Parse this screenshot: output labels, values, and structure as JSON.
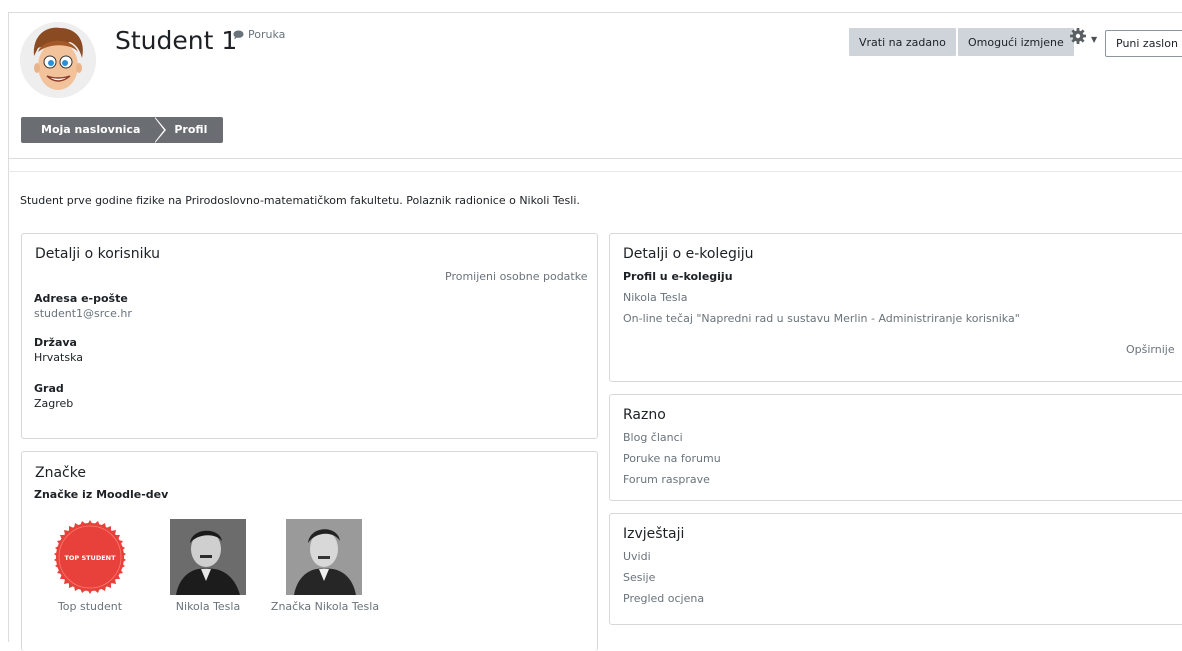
{
  "header": {
    "user_name": "Student 1",
    "message_label": "Poruka",
    "reset_label": "Vrati na zadano",
    "edit_label": "Omogući izmjene",
    "fullscreen_label": "Puni zaslon"
  },
  "breadcrumb": {
    "items": [
      {
        "label": "Moja naslovnica"
      },
      {
        "label": "Profil"
      }
    ]
  },
  "description": "Student prve godine fizike na Prirodoslovno-matematičkom fakultetu. Polaznik radionice o Nikoli Tesli.",
  "user_details": {
    "title": "Detalji o korisniku",
    "edit_link": "Promijeni osobne podatke",
    "fields": [
      {
        "label": "Adresa e-pošte",
        "value": "student1@srce.hr"
      },
      {
        "label": "Država",
        "value": "Hrvatska"
      },
      {
        "label": "Grad",
        "value": "Zagreb"
      }
    ]
  },
  "badges": {
    "title": "Značke",
    "subtitle": "Značke iz Moodle-dev",
    "items": [
      {
        "name": "Top student",
        "seal_text": "TOP STUDENT"
      },
      {
        "name": "Nikola Tesla"
      },
      {
        "name": "Značka Nikola Tesla"
      }
    ]
  },
  "course_details": {
    "title": "Detalji o e-kolegiju",
    "subtitle": "Profil u e-kolegiju",
    "items": [
      "Nikola Tesla",
      "On-line tečaj \"Napredni rad u sustavu Merlin - Administriranje korisnika\""
    ],
    "more_link": "Opširnije"
  },
  "misc": {
    "title": "Razno",
    "links": [
      "Blog članci",
      "Poruke na forumu",
      "Forum rasprave"
    ]
  },
  "reports": {
    "title": "Izvještaji",
    "links": [
      "Uvidi",
      "Sesije",
      "Pregled ocjena"
    ]
  },
  "colors": {
    "button_bg": "#ced4da",
    "breadcrumb_bg": "#6a6e72",
    "badge_red": "#e8403a",
    "muted_text": "#6a737b"
  },
  "icons": {
    "message": "speech-bubble-icon",
    "settings": "gear-icon",
    "dropdown": "caret-down-icon"
  }
}
